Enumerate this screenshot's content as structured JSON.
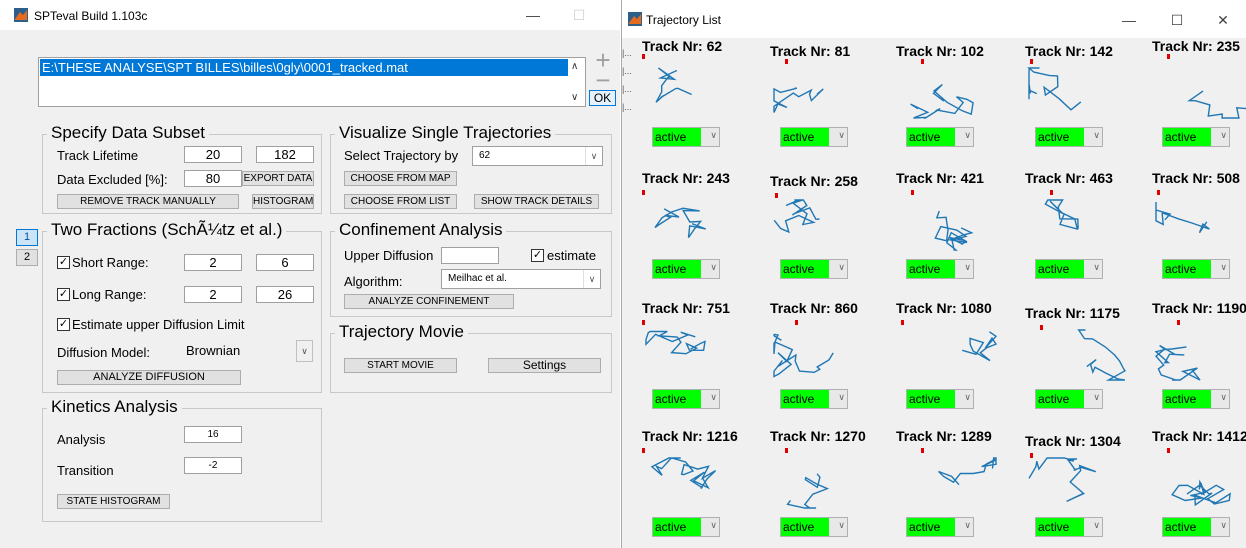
{
  "left_window": {
    "title": "SPTeval Build 1.103c",
    "window_controls": {
      "minimize": "—",
      "maximize": "☐"
    },
    "file_list": {
      "selected": "E:\\THESE ANALYSE\\SPT BILLES\\billes\\0gly\\0001_tracked.mat"
    },
    "add_button": "+",
    "remove_button": "−",
    "ok_button": "OK",
    "tabs": [
      "1",
      "2"
    ],
    "data_subset": {
      "title": "Specify Data Subset",
      "track_lifetime_label": "Track Lifetime",
      "track_lifetime_min": "20",
      "track_lifetime_max": "182",
      "data_excluded_label": "Data Excluded [%]:",
      "data_excluded_value": "80",
      "export_data": "EXPORT DATA",
      "remove_track_manually": "REMOVE TRACK MANUALLY",
      "histogram": "HISTOGRAM"
    },
    "visualize": {
      "title": "Visualize Single Trajectories",
      "select_by_label": "Select Trajectory by",
      "select_value": "62",
      "choose_from_map": "CHOOSE FROM MAP",
      "choose_from_list": "CHOOSE FROM LIST",
      "show_track_details": "SHOW TRACK DETAILS"
    },
    "two_fractions": {
      "title": "Two Fractions (SchÃ¼tz et al.)",
      "short_range_label": "Short Range:",
      "short_range_min": "2",
      "short_range_max": "6",
      "long_range_label": "Long Range:",
      "long_range_min": "2",
      "long_range_max": "26",
      "estimate_label": "Estimate upper Diffusion Limit",
      "diffusion_model_label": "Diffusion Model:",
      "diffusion_model_value": "Brownian",
      "analyze_diffusion": "ANALYZE DIFFUSION"
    },
    "confinement": {
      "title": "Confinement Analysis",
      "upper_diffusion_label": "Upper Diffusion",
      "estimate_label": "estimate",
      "algorithm_label": "Algorithm:",
      "algorithm_value": "Meilhac et al.",
      "analyze_confinement": "ANALYZE CONFINEMENT"
    },
    "movie": {
      "title": "Trajectory Movie",
      "start_movie": "START MOVIE",
      "settings": "Settings"
    },
    "kinetics": {
      "title": "Kinetics Analysis",
      "analysis_label": "Analysis",
      "analysis_value": "16",
      "transition_label": "Transition",
      "transition_value": "-2",
      "state_histogram": "STATE HISTOGRAM"
    }
  },
  "right_window": {
    "title": "Trajectory List",
    "window_controls": {
      "minimize": "—",
      "maximize": "☐",
      "close": "✕"
    },
    "status_option": "active",
    "tracks": [
      {
        "label": "Track Nr: 62"
      },
      {
        "label": "Track Nr: 81"
      },
      {
        "label": "Track Nr: 102"
      },
      {
        "label": "Track Nr: 142"
      },
      {
        "label": "Track Nr: 235"
      },
      {
        "label": "Track Nr: 243"
      },
      {
        "label": "Track Nr: 258"
      },
      {
        "label": "Track Nr: 421"
      },
      {
        "label": "Track Nr: 463"
      },
      {
        "label": "Track Nr: 508"
      },
      {
        "label": "Track Nr: 751"
      },
      {
        "label": "Track Nr: 860"
      },
      {
        "label": "Track Nr: 1080"
      },
      {
        "label": "Track Nr: 1175"
      },
      {
        "label": "Track Nr: 1190"
      },
      {
        "label": "Track Nr: 1216"
      },
      {
        "label": "Track Nr: 1270"
      },
      {
        "label": "Track Nr: 1289"
      },
      {
        "label": "Track Nr: 1304"
      },
      {
        "label": "Track Nr: 1412"
      }
    ]
  },
  "colors": {
    "trace": "#1f77b4",
    "active": "#00ff00",
    "selection": "#0078d7",
    "marker": "#e00000"
  }
}
